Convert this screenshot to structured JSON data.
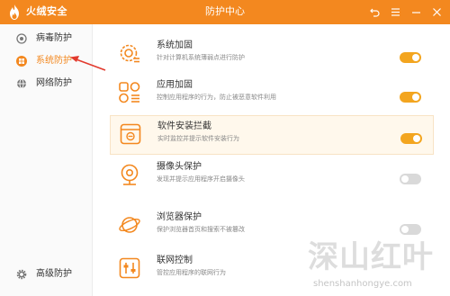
{
  "app": {
    "name": "火绒安全",
    "window_title": "防护中心",
    "brand_color": "#f3881f",
    "toggle_on_color": "#f3a51f"
  },
  "sidebar": {
    "items": [
      {
        "label": "病毒防护",
        "icon": "shield-outline-icon",
        "active": false
      },
      {
        "label": "系统防护",
        "icon": "windows-logo-icon",
        "active": true
      },
      {
        "label": "网络防护",
        "icon": "globe-icon",
        "active": false
      },
      {
        "label": "高级防护",
        "icon": "gear-icon",
        "active": false
      }
    ]
  },
  "protections": [
    {
      "title": "系统加固",
      "desc": "针对计算机系统薄弱点进行防护",
      "enabled": true,
      "icon": "gear-shield-icon"
    },
    {
      "title": "应用加固",
      "desc": "控制应用程序的行为，防止被恶意软件利用",
      "enabled": true,
      "icon": "app-grid-icon"
    },
    {
      "title": "软件安装拦截",
      "desc": "实时监控并提示软件安装行为",
      "enabled": true,
      "icon": "install-box-icon",
      "highlighted": true
    },
    {
      "title": "摄像头保护",
      "desc": "发现并提示应用程序开启摄像头",
      "enabled": false,
      "icon": "webcam-icon"
    },
    {
      "title": "浏览器保护",
      "desc": "保护浏览器首页和搜索不被篡改",
      "enabled": false,
      "icon": "planet-browser-icon"
    },
    {
      "title": "联网控制",
      "desc": "管控应用程序的联网行为",
      "enabled": false,
      "icon": "network-control-icon"
    }
  ],
  "watermark": {
    "text_cn": "深山红叶",
    "text_en": "shenshanhongye.com"
  }
}
